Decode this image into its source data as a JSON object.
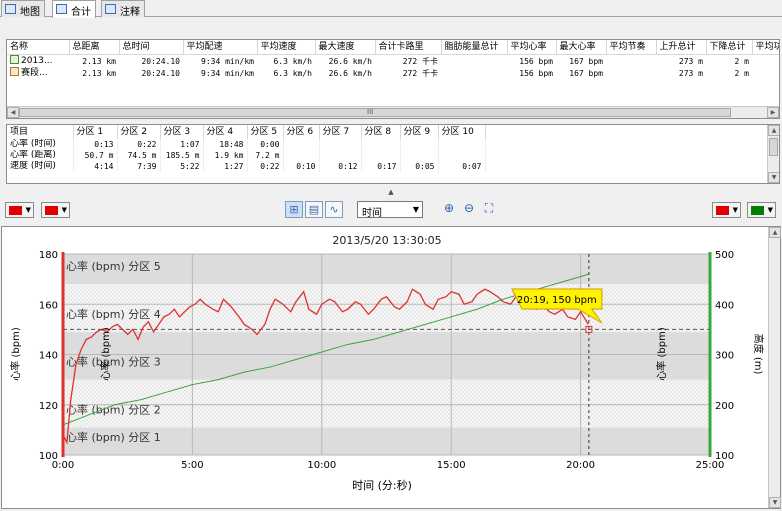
{
  "tabs": [
    {
      "label": "地图",
      "icon": "map-icon"
    },
    {
      "label": "合计",
      "icon": "table-icon"
    },
    {
      "label": "注释",
      "icon": "notes-icon"
    }
  ],
  "summary": {
    "columns": [
      "名称",
      "总距离",
      "总时间",
      "平均配速",
      "平均速度",
      "最大速度",
      "合计卡路里",
      "脂肪能量总计",
      "平均心率",
      "最大心率",
      "平均节奏",
      "上升总计",
      "下降总计",
      "平均功"
    ],
    "rows": [
      [
        "2013...",
        "2.13 km",
        "20:24.10",
        "9:34 min/km",
        "6.3 km/h",
        "26.6 km/h",
        "272 千卡",
        "",
        "156 bpm",
        "167 bpm",
        "",
        "273 m",
        "2 m",
        ""
      ],
      [
        "赛段...",
        "2.13 km",
        "20:24.10",
        "9:34 min/km",
        "6.3 km/h",
        "26.6 km/h",
        "272 千卡",
        "",
        "156 bpm",
        "167 bpm",
        "",
        "273 m",
        "2 m",
        ""
      ]
    ],
    "scroll_grip": "III"
  },
  "zones": {
    "columns": [
      "项目",
      "分区 1",
      "分区 2",
      "分区 3",
      "分区 4",
      "分区 5",
      "分区 6",
      "分区 7",
      "分区 8",
      "分区 9",
      "分区 10"
    ],
    "rows": [
      [
        "心率 (时间)",
        "0:13",
        "0:22",
        "1:07",
        "18:48",
        "0:00",
        "",
        "",
        "",
        "",
        ""
      ],
      [
        "心率 (距离)",
        "50.7 m",
        "74.5 m",
        "185.5 m",
        "1.9 km",
        "7.2 m",
        "",
        "",
        "",
        "",
        ""
      ],
      [
        "速度 (时间)",
        "4:14",
        "7:39",
        "5:22",
        "1:27",
        "0:22",
        "0:10",
        "0:12",
        "0:17",
        "0:05",
        "0:07"
      ]
    ]
  },
  "toolbar": {
    "x_axis_select": "时间",
    "left_colors": [
      "#e00000",
      "#e00000"
    ],
    "right_colors": [
      "#e00000",
      "#008000"
    ]
  },
  "chart_data": {
    "type": "line",
    "title": "2013/5/20 13:30:05",
    "xlabel": "时间 (分:秒)",
    "ylabel_left": "心率 (bpm)",
    "ylabel_left_inner": "心率 (bpm)",
    "ylabel_right_inner": "心率 (bpm)",
    "ylabel_right": "高度 (m)",
    "xlim": [
      0,
      25
    ],
    "ylim_left": [
      100,
      180
    ],
    "ylim_right": [
      100,
      500
    ],
    "x_ticks": [
      "0:00",
      "5:00",
      "10:00",
      "15:00",
      "20:00",
      "25:00"
    ],
    "y_ticks_left": [
      100,
      120,
      140,
      160,
      180
    ],
    "y_ticks_right": [
      100,
      200,
      300,
      400,
      500
    ],
    "zones": [
      {
        "label": "心率 (bpm) 分区 1",
        "from": 100,
        "to": 111
      },
      {
        "label": "心率 (bpm) 分区 2",
        "from": 111,
        "to": 130
      },
      {
        "label": "心率 (bpm) 分区 3",
        "from": 130,
        "to": 149
      },
      {
        "label": "心率 (bpm) 分区 4",
        "from": 149,
        "to": 168
      },
      {
        "label": "心率 (bpm) 分区 5",
        "from": 168,
        "to": 180
      }
    ],
    "avg_line": 150,
    "cursor": {
      "x": 20.32,
      "label": "20:19, 150 bpm"
    },
    "series": [
      {
        "name": "心率 (bpm)",
        "color": "#e03030",
        "axis": "left",
        "x": [
          0,
          0.15,
          0.3,
          0.5,
          0.7,
          0.9,
          1.1,
          1.3,
          1.5,
          1.7,
          1.9,
          2.1,
          2.3,
          2.5,
          2.7,
          2.9,
          3.1,
          3.3,
          3.5,
          3.7,
          3.9,
          4.1,
          4.3,
          4.5,
          4.7,
          4.9,
          5.1,
          5.3,
          5.5,
          5.8,
          6.0,
          6.2,
          6.5,
          6.8,
          7.0,
          7.3,
          7.5,
          7.8,
          8.0,
          8.2,
          8.5,
          8.8,
          9.0,
          9.3,
          9.5,
          9.8,
          10.0,
          10.3,
          10.5,
          10.8,
          11.0,
          11.3,
          11.5,
          11.8,
          12.0,
          12.3,
          12.5,
          12.8,
          13.0,
          13.3,
          13.5,
          13.8,
          14.0,
          14.3,
          14.5,
          14.8,
          15.0,
          15.3,
          15.5,
          15.8,
          16.0,
          16.3,
          16.5,
          16.8,
          17.0,
          17.3,
          17.5,
          17.8,
          18.0,
          18.3,
          18.5,
          18.8,
          19.0,
          19.3,
          19.5,
          19.8,
          20.0,
          20.3
        ],
        "y": [
          108,
          105,
          122,
          136,
          142,
          146,
          147,
          149,
          150,
          149,
          151,
          152,
          150,
          148,
          150,
          146,
          151,
          153,
          149,
          152,
          155,
          156,
          158,
          155,
          157,
          159,
          160,
          162,
          160,
          158,
          157,
          162,
          159,
          155,
          152,
          150,
          148,
          152,
          158,
          162,
          160,
          157,
          161,
          165,
          158,
          156,
          160,
          162,
          161,
          157,
          158,
          161,
          160,
          156,
          158,
          162,
          163,
          159,
          158,
          161,
          166,
          164,
          160,
          158,
          162,
          163,
          165,
          164,
          160,
          161,
          164,
          166,
          165,
          163,
          161,
          160,
          163,
          162,
          161,
          158,
          160,
          157,
          156,
          158,
          155,
          154,
          157,
          152
        ]
      },
      {
        "name": "高度 (m)",
        "color": "#3aa63a",
        "axis": "right",
        "x": [
          0,
          1,
          2,
          3,
          4,
          5,
          6,
          7,
          8,
          9,
          10,
          11,
          12,
          13,
          14,
          15,
          16,
          17,
          18,
          19,
          20,
          20.3
        ],
        "y": [
          160,
          180,
          200,
          210,
          225,
          240,
          250,
          265,
          275,
          290,
          305,
          320,
          330,
          345,
          360,
          375,
          390,
          410,
          425,
          440,
          455,
          460
        ]
      }
    ]
  }
}
